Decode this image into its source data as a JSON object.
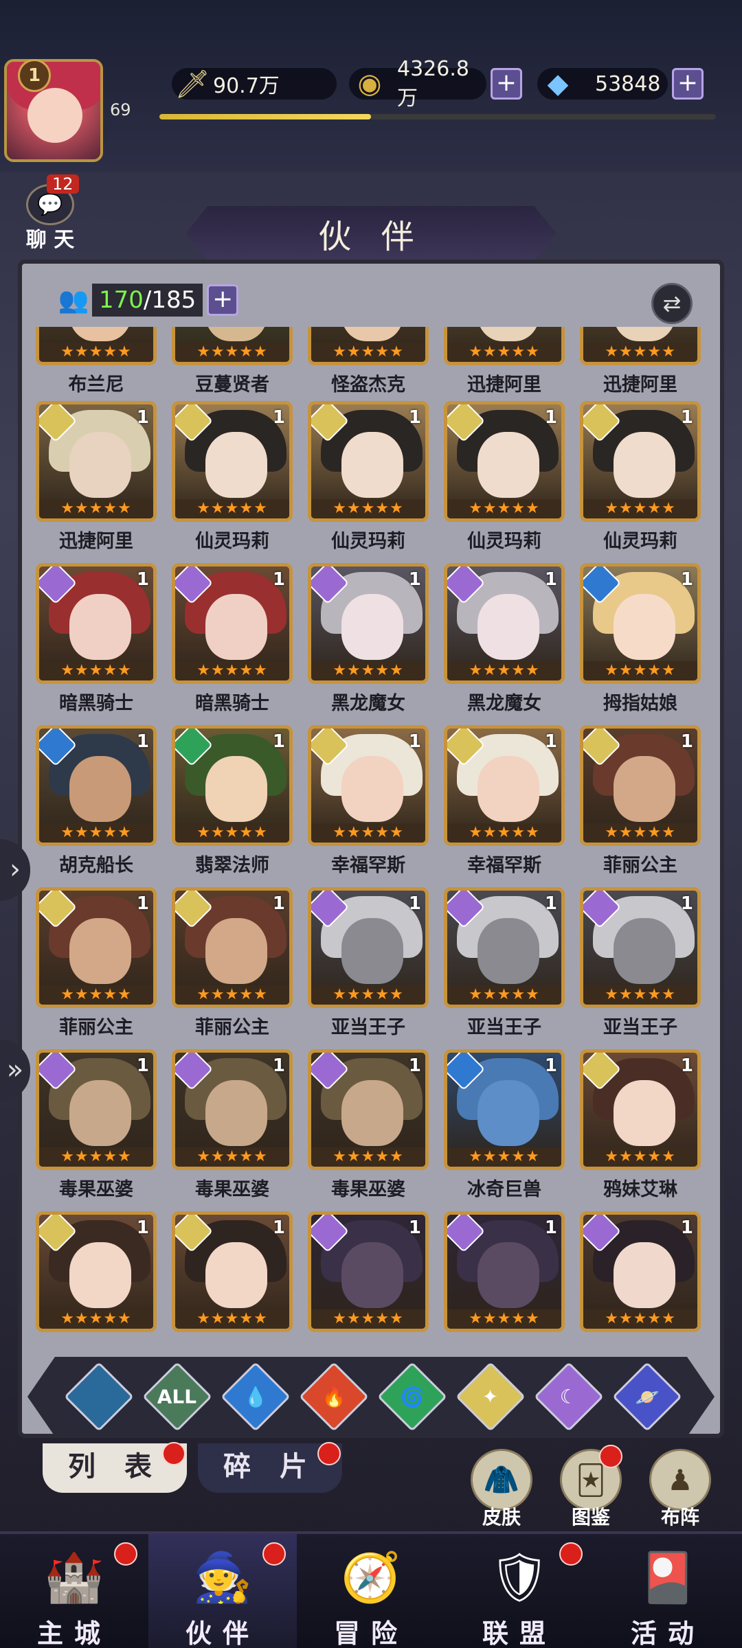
{
  "player": {
    "rank": "1",
    "level": "69",
    "xp_fraction": 0.38
  },
  "resources": {
    "power": "90.7万",
    "gold": "4326.8万",
    "gems": "53848"
  },
  "chat": {
    "label": "聊 天",
    "unread": "12"
  },
  "page_title": "伙 伴",
  "roster": {
    "owned": "170",
    "capacity": "/185"
  },
  "heroes": [
    {
      "name": "布兰尼",
      "element": "fire",
      "hair": "#8a3a2a",
      "skin": "#e8c1a0",
      "bg": "#5c4a30",
      "partial": true
    },
    {
      "name": "豆蔓贤者",
      "element": "wind",
      "hair": "#4f7a3a",
      "skin": "#d6b890",
      "bg": "#4e5c35",
      "partial": true
    },
    {
      "name": "怪盗杰克",
      "element": "light",
      "hair": "#2e2a28",
      "skin": "#e8c8a8",
      "bg": "#5c4a30",
      "partial": true
    },
    {
      "name": "迅捷阿里",
      "element": "light",
      "hair": "#d6c9a6",
      "skin": "#e8d2b8",
      "bg": "#6e5a3c",
      "partial": true
    },
    {
      "name": "迅捷阿里",
      "element": "light",
      "hair": "#d6c9a6",
      "skin": "#e8d2b8",
      "bg": "#6e5a3c",
      "partial": true
    },
    {
      "name": "迅捷阿里",
      "element": "light",
      "hair": "#d9cfb0",
      "skin": "#e8d2c0",
      "bg": "#7a6444",
      "level": "1"
    },
    {
      "name": "仙灵玛莉",
      "element": "light",
      "hair": "#2a2624",
      "skin": "#f0dccc",
      "bg": "#9a7c52",
      "level": "1"
    },
    {
      "name": "仙灵玛莉",
      "element": "light",
      "hair": "#2a2624",
      "skin": "#f0dccc",
      "bg": "#9a7c52",
      "level": "1"
    },
    {
      "name": "仙灵玛莉",
      "element": "light",
      "hair": "#2a2624",
      "skin": "#f0dccc",
      "bg": "#9a7c52",
      "level": "1"
    },
    {
      "name": "仙灵玛莉",
      "element": "light",
      "hair": "#2a2624",
      "skin": "#f0dccc",
      "bg": "#9a7c52",
      "level": "1"
    },
    {
      "name": "暗黑骑士",
      "element": "dark",
      "hair": "#9a2f30",
      "skin": "#f0d0c4",
      "bg": "#6a4a34",
      "level": "1"
    },
    {
      "name": "暗黑骑士",
      "element": "dark",
      "hair": "#9a2f30",
      "skin": "#f0d0c4",
      "bg": "#6a4a34",
      "level": "1"
    },
    {
      "name": "黑龙魔女",
      "element": "dark",
      "hair": "#b8b6bc",
      "skin": "#efe0e4",
      "bg": "#5a5662",
      "level": "1"
    },
    {
      "name": "黑龙魔女",
      "element": "dark",
      "hair": "#b8b6bc",
      "skin": "#efe0e4",
      "bg": "#5a5662",
      "level": "1"
    },
    {
      "name": "拇指姑娘",
      "element": "water",
      "hair": "#e8c98a",
      "skin": "#f6dcc8",
      "bg": "#8c7a58",
      "level": "1"
    },
    {
      "name": "胡克船长",
      "element": "water",
      "hair": "#2e3a4a",
      "skin": "#c89a78",
      "bg": "#5a4a36",
      "level": "1"
    },
    {
      "name": "翡翠法师",
      "element": "wind",
      "hair": "#3a5a2a",
      "skin": "#f0d2b4",
      "bg": "#6a5a34",
      "level": "1"
    },
    {
      "name": "幸福罕斯",
      "element": "light",
      "hair": "#ece6d8",
      "skin": "#f2d2c0",
      "bg": "#8a6a46",
      "level": "1"
    },
    {
      "name": "幸福罕斯",
      "element": "light",
      "hair": "#ece6d8",
      "skin": "#f2d2c0",
      "bg": "#8a6a46",
      "level": "1"
    },
    {
      "name": "菲丽公主",
      "element": "light",
      "hair": "#6a3a2c",
      "skin": "#d2a888",
      "bg": "#5a3e2c",
      "level": "1"
    },
    {
      "name": "菲丽公主",
      "element": "light",
      "hair": "#6a3a2c",
      "skin": "#d2a888",
      "bg": "#5a3e2c",
      "level": "1"
    },
    {
      "name": "菲丽公主",
      "element": "light",
      "hair": "#6a3a2c",
      "skin": "#d2a888",
      "bg": "#5a3e2c",
      "level": "1"
    },
    {
      "name": "亚当王子",
      "element": "dark",
      "hair": "#c8c8cc",
      "skin": "#8a8a90",
      "bg": "#4a4a52",
      "level": "1"
    },
    {
      "name": "亚当王子",
      "element": "dark",
      "hair": "#c8c8cc",
      "skin": "#8a8a90",
      "bg": "#4a4a52",
      "level": "1"
    },
    {
      "name": "亚当王子",
      "element": "dark",
      "hair": "#c8c8cc",
      "skin": "#8a8a90",
      "bg": "#4a4a52",
      "level": "1"
    },
    {
      "name": "毒果巫婆",
      "element": "dark",
      "hair": "#6a5a40",
      "skin": "#c8a88a",
      "bg": "#3e3428",
      "level": "1"
    },
    {
      "name": "毒果巫婆",
      "element": "dark",
      "hair": "#6a5a40",
      "skin": "#c8a88a",
      "bg": "#3e3428",
      "level": "1"
    },
    {
      "name": "毒果巫婆",
      "element": "dark",
      "hair": "#6a5a40",
      "skin": "#c8a88a",
      "bg": "#3e3428",
      "level": "1"
    },
    {
      "name": "冰奇巨兽",
      "element": "water",
      "hair": "#4a7ab4",
      "skin": "#5d8ec8",
      "bg": "#2e4a6e",
      "level": "1"
    },
    {
      "name": "鸦妹艾琳",
      "element": "light",
      "hair": "#4a2e26",
      "skin": "#f2d6c6",
      "bg": "#6a4a36",
      "level": "1"
    },
    {
      "name": "",
      "element": "light",
      "hair": "#3a2a22",
      "skin": "#f2d6c6",
      "bg": "#6a4a36",
      "level": "1"
    },
    {
      "name": "",
      "element": "light",
      "hair": "#2e2420",
      "skin": "#f2d6c6",
      "bg": "#6a4a36",
      "level": "1"
    },
    {
      "name": "",
      "element": "dark",
      "hair": "#3a3048",
      "skin": "#5a4a62",
      "bg": "#2e2636",
      "level": "1"
    },
    {
      "name": "",
      "element": "dark",
      "hair": "#3a3048",
      "skin": "#5a4a62",
      "bg": "#2e2636",
      "level": "1"
    },
    {
      "name": "",
      "element": "dark",
      "hair": "#2a2228",
      "skin": "#f0d8cc",
      "bg": "#4e3a30",
      "level": "1"
    }
  ],
  "stars": "★★★★★",
  "element_colors": {
    "fire": "#d9482a",
    "wind": "#2fa25a",
    "light": "#d9c25a",
    "dark": "#9a6ad2",
    "water": "#2f7ad0",
    "cosmic": "#4a52c8"
  },
  "filters": [
    {
      "icon": "all-faction-icon",
      "text": "",
      "color": "#2a6a9a"
    },
    {
      "icon": "all-icon",
      "text": "ALL",
      "color": "#4a7a5a"
    },
    {
      "icon": "water-icon",
      "text": "💧",
      "color": "#2f7ad0"
    },
    {
      "icon": "fire-icon",
      "text": "🔥",
      "color": "#d9482a"
    },
    {
      "icon": "wind-icon",
      "text": "🌀",
      "color": "#2fa25a"
    },
    {
      "icon": "light-icon",
      "text": "✦",
      "color": "#d9c25a"
    },
    {
      "icon": "dark-icon",
      "text": "☾",
      "color": "#9a6ad2"
    },
    {
      "icon": "cosmic-icon",
      "text": "🪐",
      "color": "#4a52c8"
    }
  ],
  "tabs": {
    "list": "列 表",
    "fragments": "碎 片"
  },
  "side_buttons": [
    {
      "label": "皮肤",
      "icon": "🧥"
    },
    {
      "label": "图鉴",
      "icon": "🃏"
    },
    {
      "label": "布阵",
      "icon": "♟"
    }
  ],
  "nav": [
    {
      "label": "主城",
      "icon": "🏰"
    },
    {
      "label": "伙伴",
      "icon": "🧙"
    },
    {
      "label": "冒险",
      "icon": "🧭"
    },
    {
      "label": "联盟",
      "icon": "🛡"
    },
    {
      "label": "活动",
      "icon": "🎴"
    }
  ]
}
